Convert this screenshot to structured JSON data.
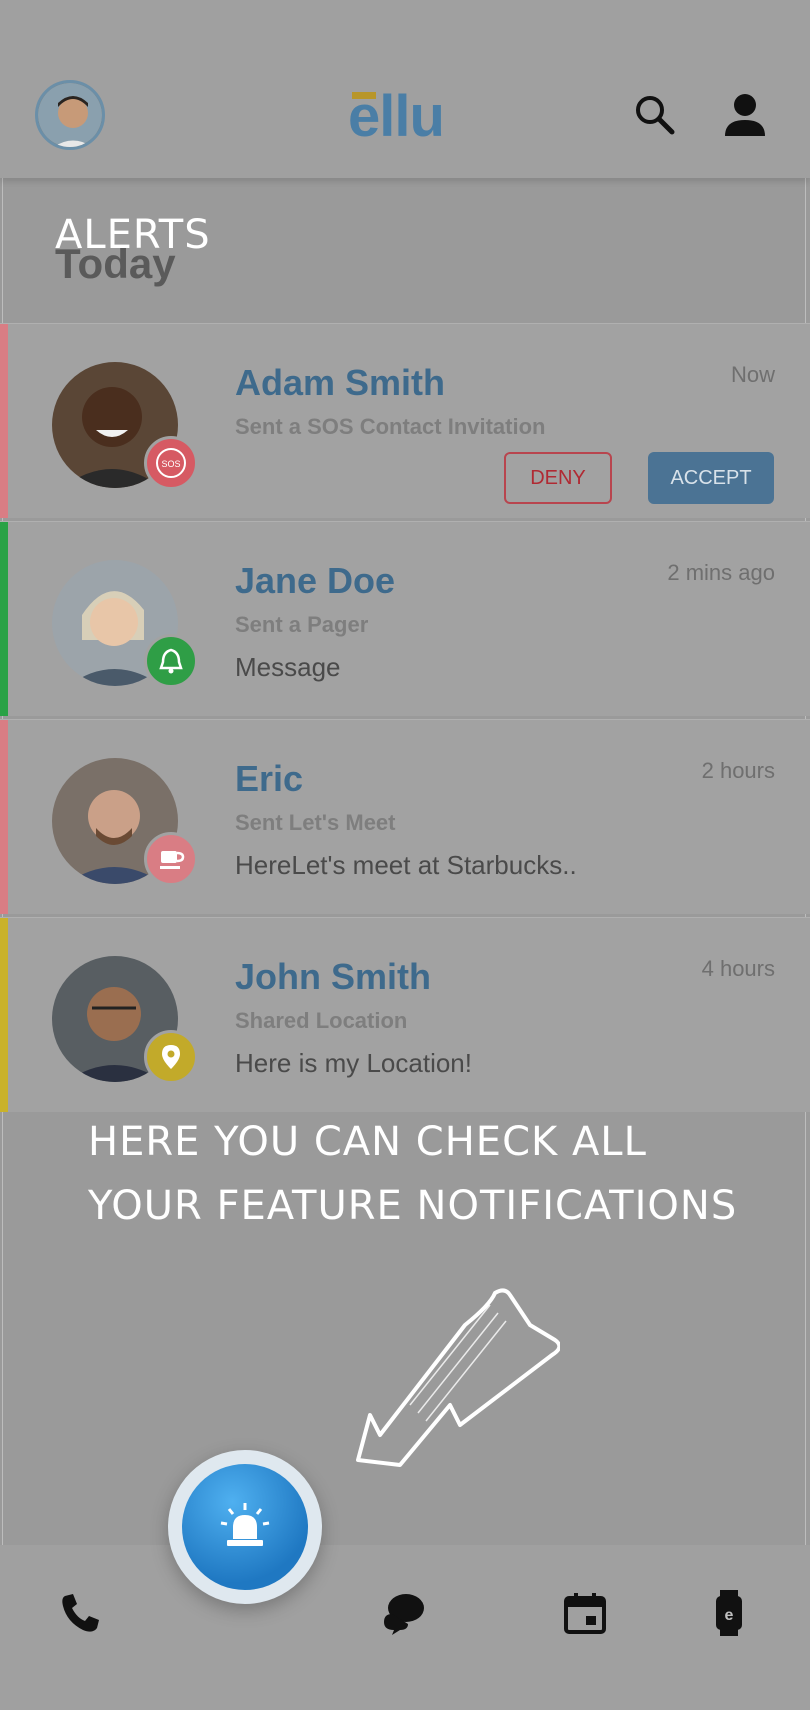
{
  "header": {
    "logo": "ellu"
  },
  "section": {
    "today_label": "Today",
    "overlay_title": "ALERTS"
  },
  "alerts": [
    {
      "name": "Adam Smith",
      "subtitle": "Sent a SOS Contact Invitation",
      "message": "",
      "time": "Now",
      "badge_icon": "sos-icon",
      "accent": "#d97d84",
      "badge_color": "#d65a63",
      "deny_label": "DENY",
      "accept_label": "ACCEPT"
    },
    {
      "name": "Jane Doe",
      "subtitle": "Sent a Pager",
      "message": "Message",
      "time": "2 mins ago",
      "badge_icon": "bell-icon",
      "accent": "#2aa246",
      "badge_color": "#2f9e46"
    },
    {
      "name": "Eric",
      "subtitle": "Sent Let's Meet",
      "message": "HereLet's meet at Starbucks..",
      "time": "2 hours",
      "badge_icon": "coffee-icon",
      "accent": "#d97d84",
      "badge_color": "#d97d84"
    },
    {
      "name": "John Smith",
      "subtitle": "Shared Location",
      "message": "Here is my Location!",
      "time": "4 hours",
      "badge_icon": "location-pin-icon",
      "accent": "#c9b22a",
      "badge_color": "#c2aa2a"
    }
  ],
  "onboarding": {
    "line1": "HERE YOU CAN CHECK ALL",
    "line2": "YOUR FEATURE NOTIFICATIONS"
  },
  "nav": {
    "items": [
      "phone-icon",
      "alert-siren-icon",
      "chat-icon",
      "calendar-icon",
      "watch-icon"
    ]
  }
}
